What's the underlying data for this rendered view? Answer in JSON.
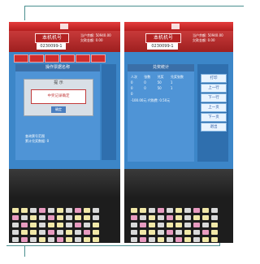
{
  "left_photo": {
    "header": {
      "title": "本机机号",
      "machine_no": "0230099-1",
      "info_lines": [
        "当户余额: 50940.00",
        "欠款金额:    0.00"
      ]
    },
    "panel_title": "操作票据名称",
    "dialog": {
      "title": "提  示",
      "message": "中奖记录确定",
      "ok_label": "确定"
    },
    "footnote_lines": [
      "查询票号范围",
      "累计兑奖数据:        0"
    ]
  },
  "right_photo": {
    "header": {
      "title": "本机机号",
      "machine_no": "0230099-1",
      "info_lines": [
        "当户余额: 50940.00",
        "欠款金额:    0.00"
      ]
    },
    "report": {
      "title": "兑奖统计",
      "columns": [
        "人次",
        "张数",
        "兑奖",
        "兑奖张数"
      ],
      "rows": [
        [
          "0",
          "0",
          "50",
          "1"
        ],
        [
          "0",
          "0",
          "50",
          "1"
        ],
        [
          "0",
          "",
          "",
          ""
        ]
      ],
      "total_line": "-100.00元    代购费:      0.50元"
    },
    "side_buttons": [
      "打印",
      "上一行",
      "下一行",
      "上一页",
      "下一页",
      "退出"
    ]
  },
  "keyboard": {
    "left_wide_keys": [
      "打印",
      "确定"
    ],
    "right_wide_keys": [
      "打印",
      "确定"
    ]
  },
  "colors": {
    "frame": "#4a8f8f",
    "screen_blue": "#3c86c8",
    "ribbon_red": "#b51e1e",
    "key_yellow": "#f1e8a8",
    "key_pink": "#e89bc0",
    "key_gray": "#d9d9d9"
  }
}
